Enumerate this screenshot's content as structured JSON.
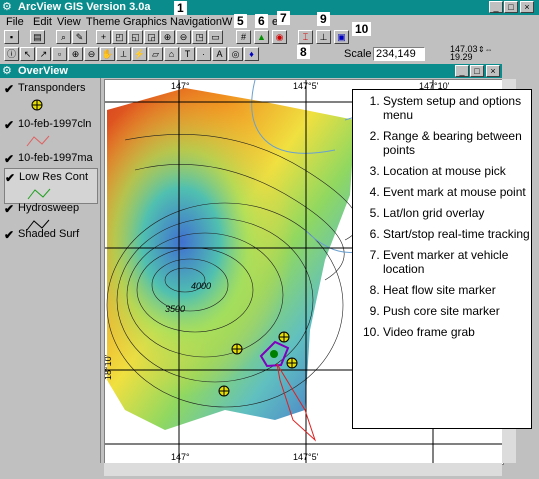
{
  "app": {
    "title": "ArcView GIS Version 3.0a"
  },
  "menu": [
    "File",
    "Edit",
    "View",
    "Theme",
    "Graphics",
    "Navigation",
    "Window",
    "Help"
  ],
  "menu_visible": {
    "win_partial": "W",
    "help_partial": "el"
  },
  "numbers": [
    "1",
    "2",
    "3",
    "4",
    "5",
    "6",
    "7",
    "8",
    "9",
    "10"
  ],
  "scale": {
    "label": "Scale",
    "value": "234,149"
  },
  "coords": {
    "lon": "147.03",
    "lat": "19.29"
  },
  "overview": {
    "title": "OverView"
  },
  "layers": [
    {
      "name": "Transponders",
      "checked": true
    },
    {
      "name": "10-feb-1997cln",
      "checked": true
    },
    {
      "name": "10-feb-1997ma",
      "checked": true
    },
    {
      "name": "Low Res Cont",
      "checked": true
    },
    {
      "name": "Hydrosweep",
      "checked": true
    },
    {
      "name": "Shaded Surf",
      "checked": true
    }
  ],
  "map": {
    "grid_top": [
      "147°",
      "147°5'",
      "147°10'"
    ],
    "grid_bottom": [
      "147°",
      "147°5'"
    ],
    "grid_left": [
      "18°10'"
    ],
    "contours": [
      "4000",
      "3500"
    ]
  },
  "legend": [
    "System setup and options menu",
    "Range & bearing between points",
    "Location at mouse pick",
    "Event mark at mouse point",
    "Lat/lon grid overlay",
    "Start/stop real-time tracking",
    "Event marker at vehicle location",
    "Heat flow site marker",
    "Push core site marker",
    "Video frame grab"
  ],
  "colors": {
    "titlebar": "#0a8c8c",
    "window_bg": "#c0c0c0"
  }
}
